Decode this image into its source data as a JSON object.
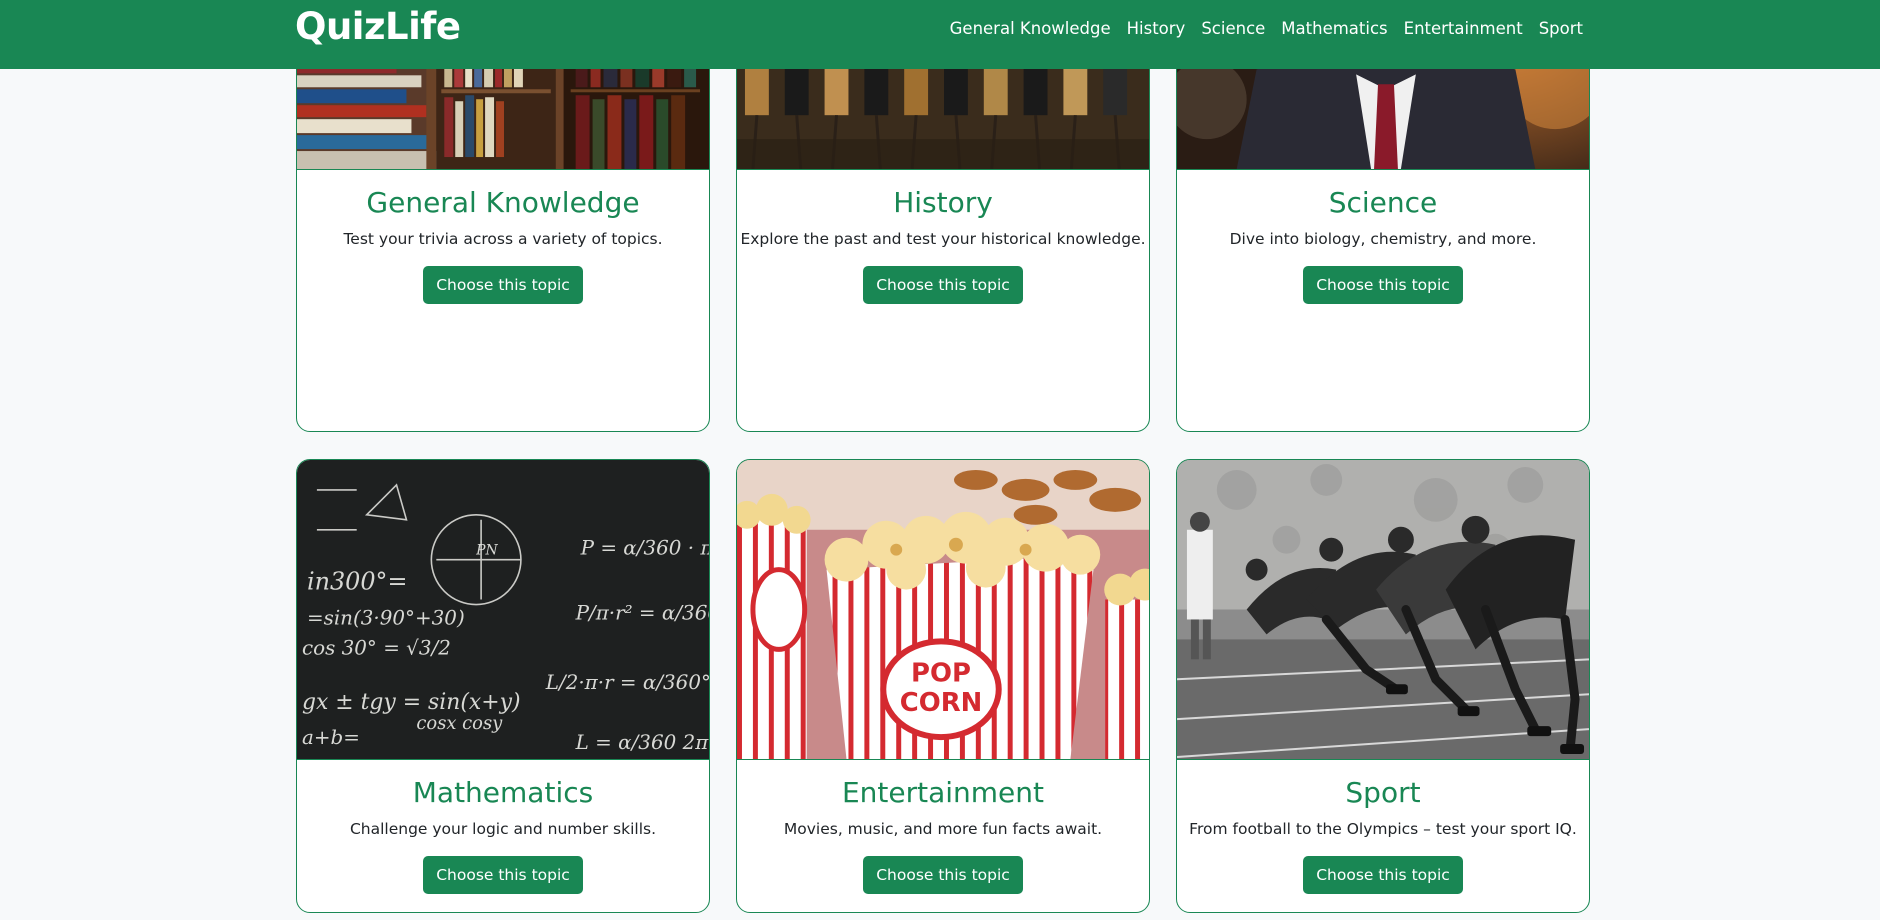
{
  "brand": "QuizLife",
  "nav": [
    {
      "label": "General Knowledge"
    },
    {
      "label": "History"
    },
    {
      "label": "Science"
    },
    {
      "label": "Mathematics"
    },
    {
      "label": "Entertainment"
    },
    {
      "label": "Sport"
    }
  ],
  "cards": [
    {
      "title": "General Knowledge",
      "text": "Test your trivia across a variety of topics.",
      "button": "Choose this topic",
      "image": "library-bookshelves"
    },
    {
      "title": "History",
      "text": "Explore the past and test your historical knowledge.",
      "button": "Choose this topic",
      "image": "historical-painting-militia"
    },
    {
      "title": "Science",
      "text": "Dive into biology, chemistry, and more.",
      "button": "Choose this topic",
      "image": "scientist-figurine"
    },
    {
      "title": "Mathematics",
      "text": "Challenge your logic and number skills.",
      "button": "Choose this topic",
      "image": "chalkboard-equations"
    },
    {
      "title": "Entertainment",
      "text": "Movies, music, and more fun facts await.",
      "button": "Choose this topic",
      "image": "popcorn-boxes"
    },
    {
      "title": "Sport",
      "text": "From football to the Olympics – test your sport IQ.",
      "button": "Choose this topic",
      "image": "sprinters-starting"
    }
  ],
  "colors": {
    "primary": "#198754",
    "background": "#f7f9fa",
    "text": "#212529"
  }
}
